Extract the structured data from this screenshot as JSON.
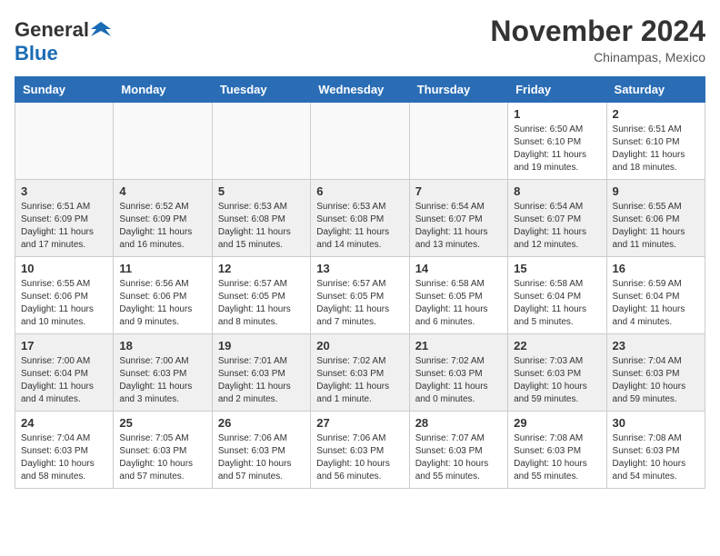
{
  "header": {
    "logo_general": "General",
    "logo_blue": "Blue",
    "month_title": "November 2024",
    "location": "Chinampas, Mexico"
  },
  "calendar": {
    "days_of_week": [
      "Sunday",
      "Monday",
      "Tuesday",
      "Wednesday",
      "Thursday",
      "Friday",
      "Saturday"
    ],
    "weeks": [
      [
        {
          "day": "",
          "info": ""
        },
        {
          "day": "",
          "info": ""
        },
        {
          "day": "",
          "info": ""
        },
        {
          "day": "",
          "info": ""
        },
        {
          "day": "",
          "info": ""
        },
        {
          "day": "1",
          "info": "Sunrise: 6:50 AM\nSunset: 6:10 PM\nDaylight: 11 hours and 19 minutes."
        },
        {
          "day": "2",
          "info": "Sunrise: 6:51 AM\nSunset: 6:10 PM\nDaylight: 11 hours and 18 minutes."
        }
      ],
      [
        {
          "day": "3",
          "info": "Sunrise: 6:51 AM\nSunset: 6:09 PM\nDaylight: 11 hours and 17 minutes."
        },
        {
          "day": "4",
          "info": "Sunrise: 6:52 AM\nSunset: 6:09 PM\nDaylight: 11 hours and 16 minutes."
        },
        {
          "day": "5",
          "info": "Sunrise: 6:53 AM\nSunset: 6:08 PM\nDaylight: 11 hours and 15 minutes."
        },
        {
          "day": "6",
          "info": "Sunrise: 6:53 AM\nSunset: 6:08 PM\nDaylight: 11 hours and 14 minutes."
        },
        {
          "day": "7",
          "info": "Sunrise: 6:54 AM\nSunset: 6:07 PM\nDaylight: 11 hours and 13 minutes."
        },
        {
          "day": "8",
          "info": "Sunrise: 6:54 AM\nSunset: 6:07 PM\nDaylight: 11 hours and 12 minutes."
        },
        {
          "day": "9",
          "info": "Sunrise: 6:55 AM\nSunset: 6:06 PM\nDaylight: 11 hours and 11 minutes."
        }
      ],
      [
        {
          "day": "10",
          "info": "Sunrise: 6:55 AM\nSunset: 6:06 PM\nDaylight: 11 hours and 10 minutes."
        },
        {
          "day": "11",
          "info": "Sunrise: 6:56 AM\nSunset: 6:06 PM\nDaylight: 11 hours and 9 minutes."
        },
        {
          "day": "12",
          "info": "Sunrise: 6:57 AM\nSunset: 6:05 PM\nDaylight: 11 hours and 8 minutes."
        },
        {
          "day": "13",
          "info": "Sunrise: 6:57 AM\nSunset: 6:05 PM\nDaylight: 11 hours and 7 minutes."
        },
        {
          "day": "14",
          "info": "Sunrise: 6:58 AM\nSunset: 6:05 PM\nDaylight: 11 hours and 6 minutes."
        },
        {
          "day": "15",
          "info": "Sunrise: 6:58 AM\nSunset: 6:04 PM\nDaylight: 11 hours and 5 minutes."
        },
        {
          "day": "16",
          "info": "Sunrise: 6:59 AM\nSunset: 6:04 PM\nDaylight: 11 hours and 4 minutes."
        }
      ],
      [
        {
          "day": "17",
          "info": "Sunrise: 7:00 AM\nSunset: 6:04 PM\nDaylight: 11 hours and 4 minutes."
        },
        {
          "day": "18",
          "info": "Sunrise: 7:00 AM\nSunset: 6:03 PM\nDaylight: 11 hours and 3 minutes."
        },
        {
          "day": "19",
          "info": "Sunrise: 7:01 AM\nSunset: 6:03 PM\nDaylight: 11 hours and 2 minutes."
        },
        {
          "day": "20",
          "info": "Sunrise: 7:02 AM\nSunset: 6:03 PM\nDaylight: 11 hours and 1 minute."
        },
        {
          "day": "21",
          "info": "Sunrise: 7:02 AM\nSunset: 6:03 PM\nDaylight: 11 hours and 0 minutes."
        },
        {
          "day": "22",
          "info": "Sunrise: 7:03 AM\nSunset: 6:03 PM\nDaylight: 10 hours and 59 minutes."
        },
        {
          "day": "23",
          "info": "Sunrise: 7:04 AM\nSunset: 6:03 PM\nDaylight: 10 hours and 59 minutes."
        }
      ],
      [
        {
          "day": "24",
          "info": "Sunrise: 7:04 AM\nSunset: 6:03 PM\nDaylight: 10 hours and 58 minutes."
        },
        {
          "day": "25",
          "info": "Sunrise: 7:05 AM\nSunset: 6:03 PM\nDaylight: 10 hours and 57 minutes."
        },
        {
          "day": "26",
          "info": "Sunrise: 7:06 AM\nSunset: 6:03 PM\nDaylight: 10 hours and 57 minutes."
        },
        {
          "day": "27",
          "info": "Sunrise: 7:06 AM\nSunset: 6:03 PM\nDaylight: 10 hours and 56 minutes."
        },
        {
          "day": "28",
          "info": "Sunrise: 7:07 AM\nSunset: 6:03 PM\nDaylight: 10 hours and 55 minutes."
        },
        {
          "day": "29",
          "info": "Sunrise: 7:08 AM\nSunset: 6:03 PM\nDaylight: 10 hours and 55 minutes."
        },
        {
          "day": "30",
          "info": "Sunrise: 7:08 AM\nSunset: 6:03 PM\nDaylight: 10 hours and 54 minutes."
        }
      ]
    ]
  }
}
